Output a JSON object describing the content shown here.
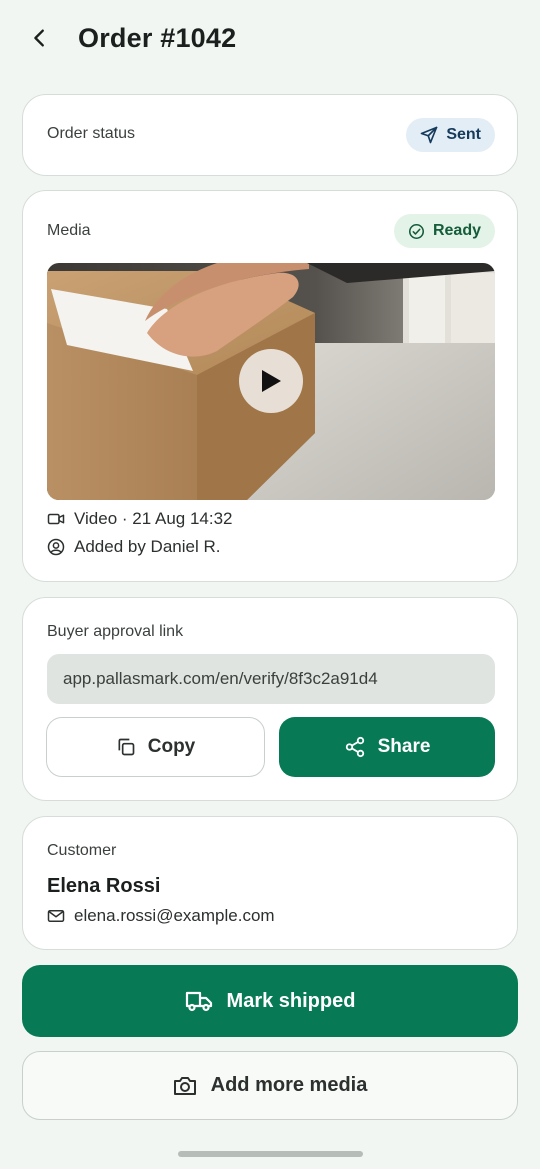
{
  "header": {
    "title": "Order #1042",
    "back_icon": "chevron-left-icon"
  },
  "status_card": {
    "label": "Order status",
    "status": "Sent",
    "status_icon": "send-icon",
    "status_color": "#163a5b"
  },
  "media_card": {
    "label": "Media",
    "badge": "Ready",
    "badge_icon": "check-circle-icon",
    "badge_color": "#145c3a",
    "thumbnail_icon": "play-icon",
    "video_meta": "Video · 21 Aug 14:32",
    "added_by": "Added by Daniel R."
  },
  "approval_card": {
    "label": "Buyer approval link",
    "link": "app.pallasmark.com/en/verify/8f3c2a91d4",
    "copy_label": "Copy",
    "share_label": "Share"
  },
  "customer_card": {
    "label": "Customer",
    "name": "Elena Rossi",
    "email": "elena.rossi@example.com"
  },
  "actions": {
    "mark_shipped": "Mark shipped",
    "add_media": "Add more media"
  },
  "colors": {
    "accent": "#077a55",
    "background": "#f1f6f2"
  }
}
